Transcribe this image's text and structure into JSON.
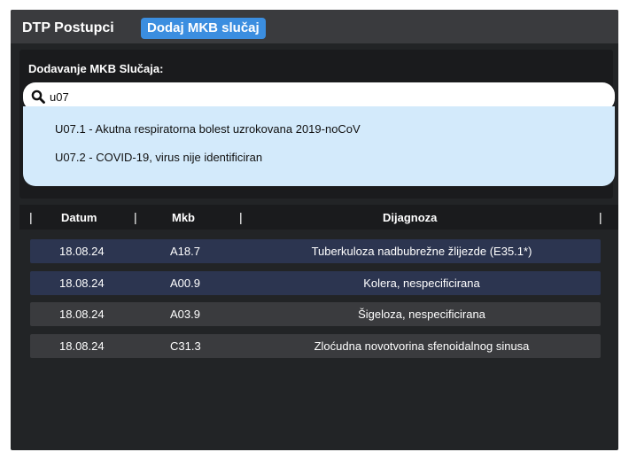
{
  "tabs": [
    {
      "label": "DTP Postupci"
    },
    {
      "label": "Dodaj MKB slučaj"
    }
  ],
  "panel": {
    "title": "Dodavanje MKB Slučaja:",
    "search": {
      "value": "u07",
      "placeholder": ""
    },
    "suggestions": [
      "U07.1 - Akutna respiratorna bolest uzrokovana 2019-noCoV",
      "U07.2 - COVID-19, virus nije identificiran"
    ]
  },
  "table": {
    "headers": {
      "datum": "Datum",
      "mkb": "Mkb",
      "dijagnoza": "Dijagnoza"
    },
    "separator": "|",
    "rows": [
      {
        "datum": "18.08.24",
        "mkb": "A18.7",
        "dijagnoza": "Tuberkuloza nadbubrežne žlijezde (E35.1*)"
      },
      {
        "datum": "18.08.24",
        "mkb": "A00.9",
        "dijagnoza": "Kolera, nespecificirana"
      },
      {
        "datum": "18.08.24",
        "mkb": "A03.9",
        "dijagnoza": "Šigeloza, nespecificirana"
      },
      {
        "datum": "18.08.24",
        "mkb": "C31.3",
        "dijagnoza": "Zloćudna novotvorina sfenoidalnog sinusa"
      }
    ]
  },
  "colors": {
    "accent": "#3b8ee0",
    "background": "#222426",
    "highlight_row": "#2c3550",
    "plain_row": "#3a3b3e",
    "dropdown": "#d3eafb"
  },
  "icons": {
    "search": "search-icon"
  }
}
